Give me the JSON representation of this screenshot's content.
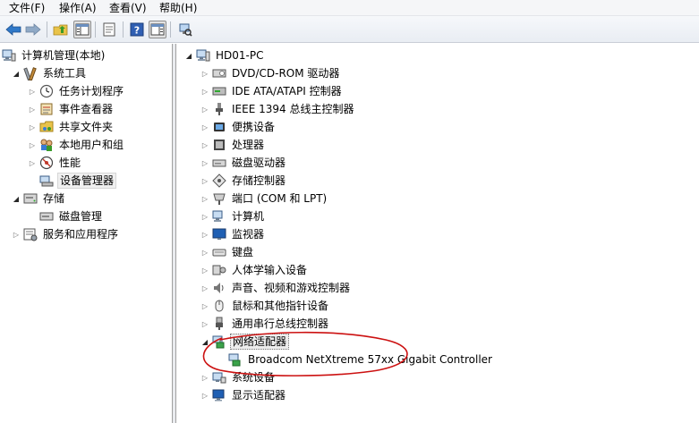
{
  "menubar": {
    "items": [
      {
        "label": "文件(F)"
      },
      {
        "label": "操作(A)"
      },
      {
        "label": "查看(V)"
      },
      {
        "label": "帮助(H)"
      }
    ]
  },
  "toolbar": {
    "buttons": [
      {
        "icon": "back-arrow-icon"
      },
      {
        "icon": "forward-arrow-icon"
      },
      {
        "icon": "up-folder-icon"
      },
      {
        "icon": "show-hide-console-tree-icon"
      },
      {
        "icon": "properties-icon"
      },
      {
        "icon": "help-icon"
      },
      {
        "icon": "action-pane-icon"
      },
      {
        "icon": "scan-hardware-icon"
      }
    ]
  },
  "left_tree": {
    "root": "计算机管理(本地)",
    "system_tools": "系统工具",
    "task_scheduler": "任务计划程序",
    "event_viewer": "事件查看器",
    "shared_folders": "共享文件夹",
    "local_users": "本地用户和组",
    "performance": "性能",
    "device_manager": "设备管理器",
    "storage": "存储",
    "disk_management": "磁盘管理",
    "services_apps": "服务和应用程序"
  },
  "device_tree": {
    "computer_name": "HD01-PC",
    "categories": [
      {
        "label": "DVD/CD-ROM 驱动器",
        "icon": "dvd-drive-icon"
      },
      {
        "label": "IDE ATA/ATAPI 控制器",
        "icon": "ide-controller-icon"
      },
      {
        "label": "IEEE 1394 总线主控制器",
        "icon": "ieee1394-icon"
      },
      {
        "label": "便携设备",
        "icon": "portable-device-icon"
      },
      {
        "label": "处理器",
        "icon": "processor-icon"
      },
      {
        "label": "磁盘驱动器",
        "icon": "disk-drive-icon"
      },
      {
        "label": "存储控制器",
        "icon": "storage-controller-icon"
      },
      {
        "label": "端口 (COM 和 LPT)",
        "icon": "port-icon"
      },
      {
        "label": "计算机",
        "icon": "computer-icon"
      },
      {
        "label": "监视器",
        "icon": "monitor-icon"
      },
      {
        "label": "键盘",
        "icon": "keyboard-icon"
      },
      {
        "label": "人体学输入设备",
        "icon": "hid-icon"
      },
      {
        "label": "声音、视频和游戏控制器",
        "icon": "sound-icon"
      },
      {
        "label": "鼠标和其他指针设备",
        "icon": "mouse-icon"
      },
      {
        "label": "通用串行总线控制器",
        "icon": "usb-icon"
      }
    ],
    "network_adapters": "网络适配器",
    "network_child": "Broadcom NetXtreme 57xx Gigabit Controller",
    "system_devices": "系统设备",
    "display_adapters": "显示适配器"
  },
  "colors": {
    "annotation": "#cc1111",
    "selection": "#f0f0f0"
  }
}
